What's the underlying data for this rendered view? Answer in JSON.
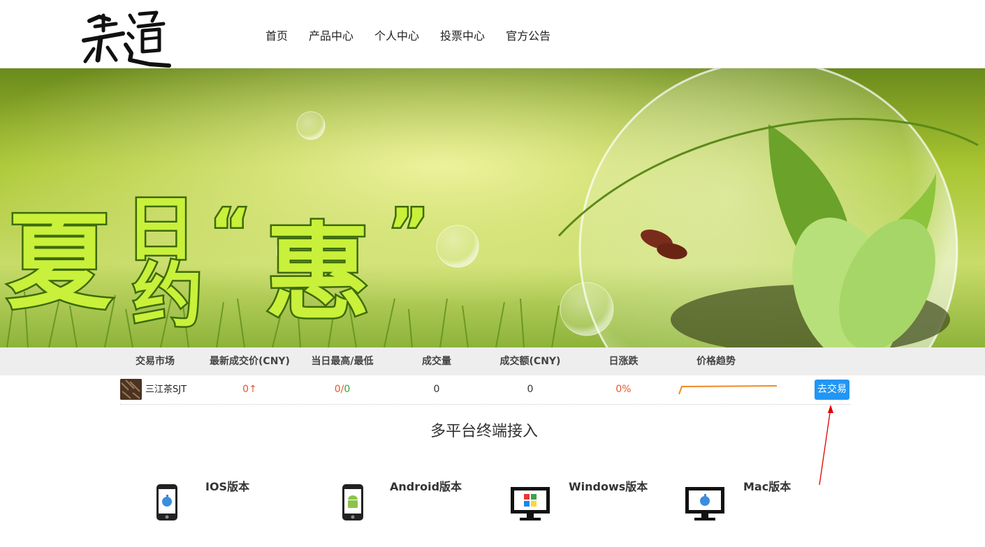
{
  "header": {
    "nav": [
      "首页",
      "产品中心",
      "个人中心",
      "投票中心",
      "官方公告"
    ]
  },
  "banner": {
    "headline": "夏日约“惠”",
    "slides": 3,
    "active_slide": 1
  },
  "market": {
    "headers": [
      "交易市场",
      "最新成交价(CNY)",
      "当日最高/最低",
      "成交量",
      "成交额(CNY)",
      "日涨跌",
      "价格趋势"
    ],
    "rows": [
      {
        "name": "三江茶SJT",
        "last_price": "0↑",
        "high": "0",
        "sep": "/",
        "low": "0",
        "volume": "0",
        "turnover": "0",
        "change": "0%",
        "action": "去交易"
      }
    ]
  },
  "section": {
    "title": "多平台终端接入"
  },
  "platforms": [
    {
      "label": "IOS版本",
      "icon": "phone-apple-icon"
    },
    {
      "label": "Android版本",
      "icon": "phone-android-icon"
    },
    {
      "label": "Windows版本",
      "icon": "monitor-windows-icon"
    },
    {
      "label": "Mac版本",
      "icon": "monitor-apple-icon"
    }
  ],
  "colors": {
    "accent": "#2196f3",
    "up": "#e8572d",
    "down": "#3aa13a",
    "trend": "#f08a24"
  }
}
